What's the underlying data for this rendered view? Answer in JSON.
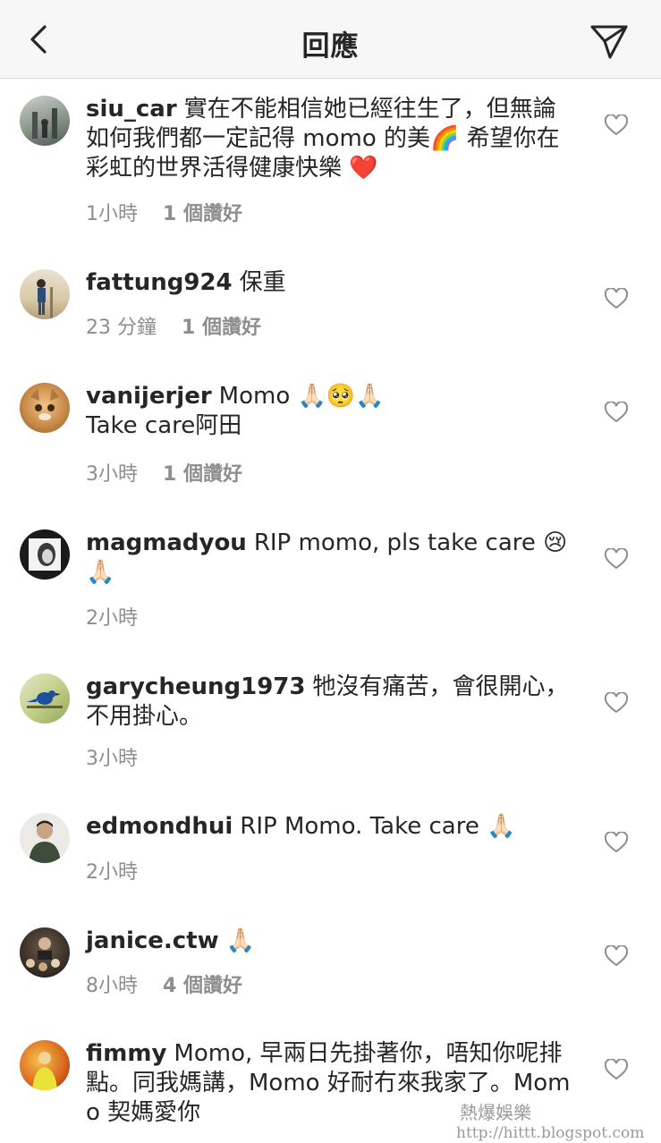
{
  "header": {
    "title": "回應",
    "back_icon": "chevron-left-icon",
    "send_icon": "paper-plane-icon"
  },
  "comments": [
    {
      "username": "siu_car",
      "text": "實在不能相信她已經往生了，但無論如何我們都一定記得 momo 的美🌈 希望你在彩虹的世界活得健康快樂 ❤️",
      "time": "1小時",
      "likes": "1 個讚好"
    },
    {
      "username": "fattung924",
      "text": "保重",
      "time": "23 分鐘",
      "likes": "1 個讚好"
    },
    {
      "username": "vanijerjer",
      "text": "Momo 🙏🏻🥺🙏🏻",
      "text2": "Take care阿田",
      "time": "3小時",
      "likes": "1 個讚好"
    },
    {
      "username": "magmadyou",
      "text": "RIP momo, pls take care 😢🙏🏻",
      "time": "2小時",
      "likes": ""
    },
    {
      "username": "garycheung1973",
      "text": "牠沒有痛苦，會很開心，不用掛心。",
      "time": "3小時",
      "likes": ""
    },
    {
      "username": "edmondhui",
      "text": "RIP Momo. Take care 🙏🏻",
      "time": "2小時",
      "likes": ""
    },
    {
      "username": "janice.ctw",
      "text": "🙏🏻",
      "time": "8小時",
      "likes": "4 個讚好"
    },
    {
      "username": "fimmy",
      "text": "Momo, 早兩日先掛著你，唔知你呢排點。同我媽講，Momo 好耐冇來我家了。Momo 契媽愛你",
      "time": "",
      "likes": ""
    }
  ],
  "watermark": {
    "line1": "熱爆娛樂",
    "line2": "http://hittt.blogspot.com"
  }
}
